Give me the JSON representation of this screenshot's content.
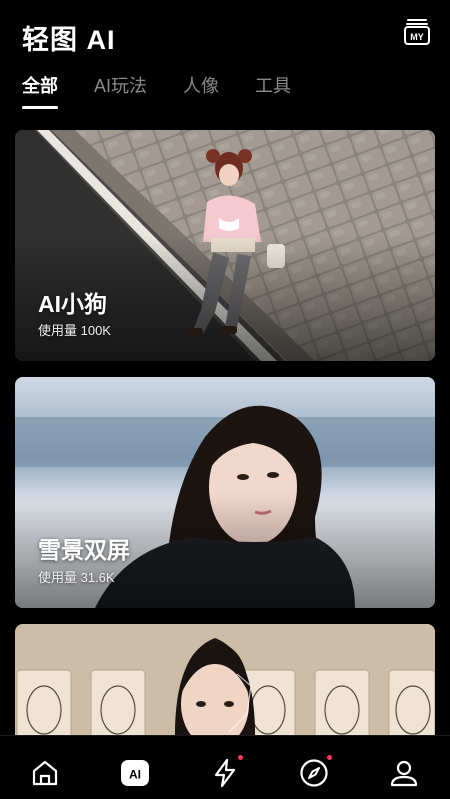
{
  "app": {
    "title": "轻图 AI",
    "my_badge": "MY"
  },
  "tabs": [
    {
      "label": "全部",
      "active": true
    },
    {
      "label": "AI玩法",
      "active": false
    },
    {
      "label": "人像",
      "active": false
    },
    {
      "label": "工具",
      "active": false
    }
  ],
  "cards": [
    {
      "title": "AI小狗",
      "usage": "使用量 100K"
    },
    {
      "title": "雪景双屏",
      "usage": "使用量 31.6K"
    },
    {
      "title": "",
      "usage": ""
    }
  ],
  "bottom_nav": {
    "ai_label": "AI",
    "items": [
      "home-icon",
      "ai-icon",
      "lightning-icon",
      "compass-icon",
      "profile-icon"
    ],
    "notification_color": "#ff3b5c"
  }
}
